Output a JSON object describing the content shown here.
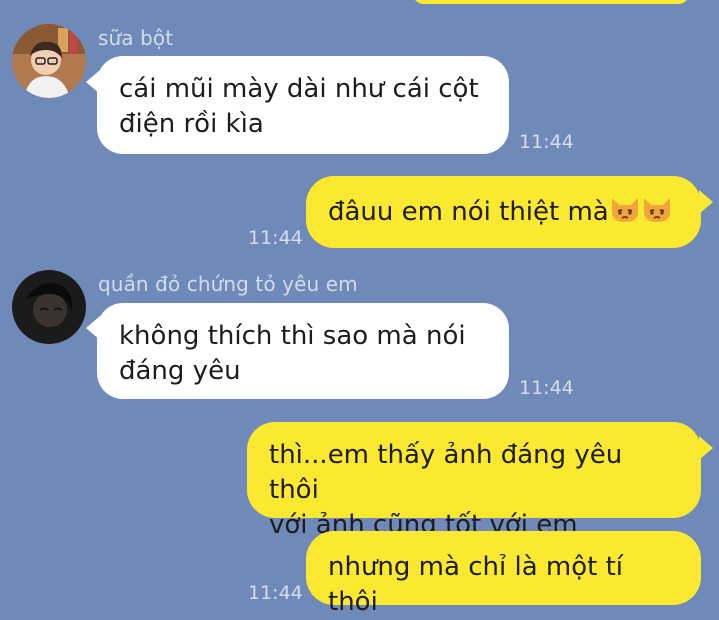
{
  "messages": [
    {
      "id": 1,
      "direction": "incoming",
      "sender": "sữa bột",
      "text_line1": "cái mũi mày dài như cái cột",
      "text_line2": "điện rồi kìa",
      "time": "11:44"
    },
    {
      "id": 2,
      "direction": "outgoing",
      "text": "đâuu em nói thiệt mà",
      "emoji": [
        "pouting-cat-icon",
        "pouting-cat-icon"
      ],
      "time": "11:44"
    },
    {
      "id": 3,
      "direction": "incoming",
      "sender": "quần đỏ chứng tỏ yêu em",
      "text_line1": "không thích thì sao mà nói",
      "text_line2": "đáng yêu",
      "time": "11:44"
    },
    {
      "id": 4,
      "direction": "outgoing",
      "text_line1": "thì...em thấy ảnh đáng yêu thôi",
      "text_line2": "với ảnh cũng tốt với em"
    },
    {
      "id": 5,
      "direction": "outgoing",
      "text": "nhưng mà chỉ là một tí thôi",
      "time": "11:44"
    }
  ],
  "colors": {
    "background": "#6f8ab8",
    "incoming_bubble": "#ffffff",
    "outgoing_bubble": "#fbe830",
    "meta_text": "#d3dcec"
  }
}
